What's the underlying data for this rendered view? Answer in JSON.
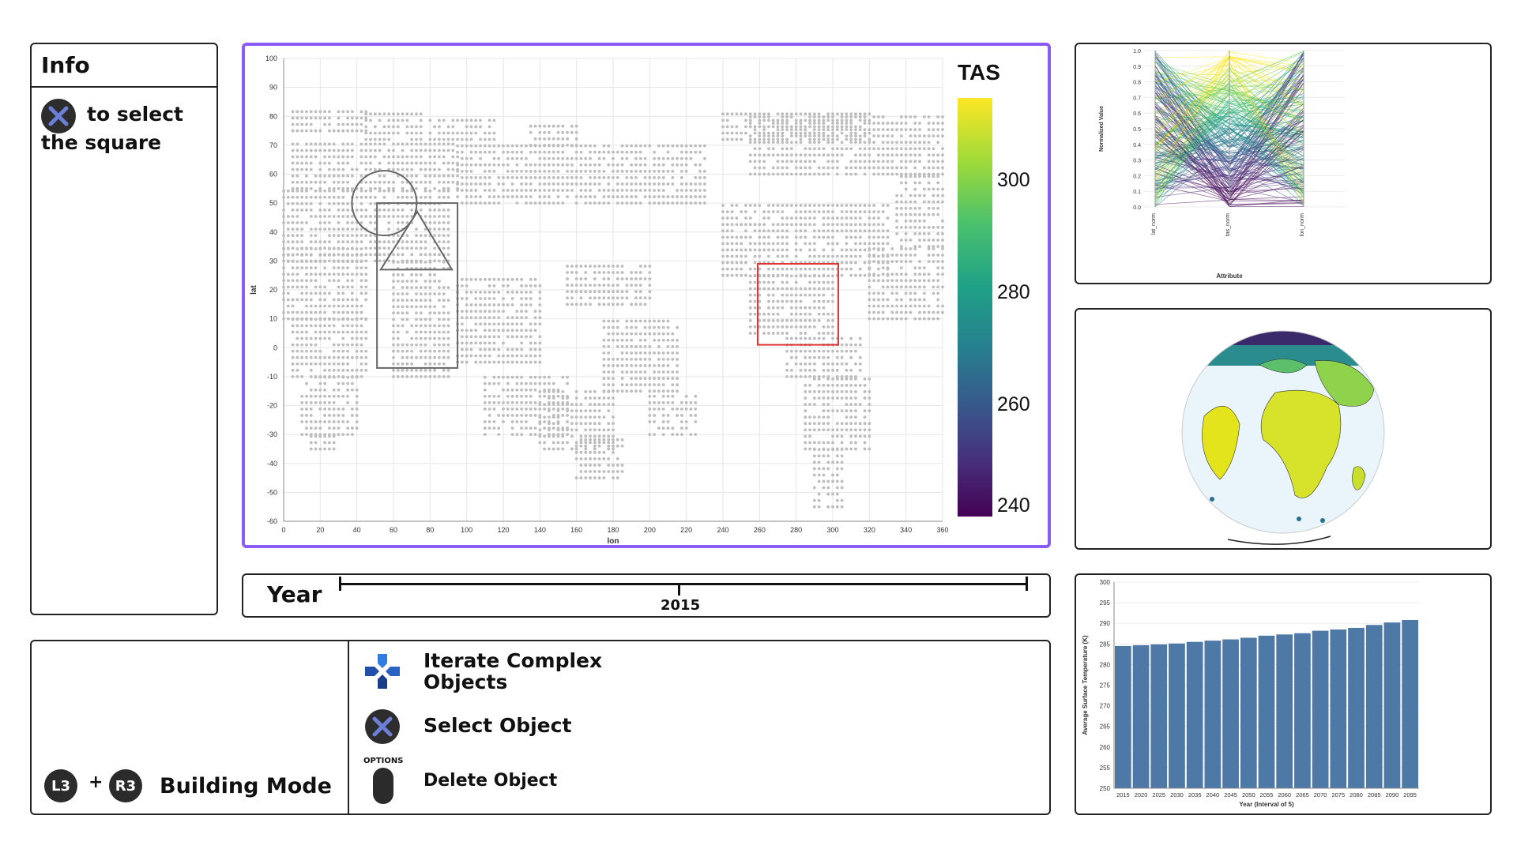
{
  "info": {
    "title": "Info",
    "hint_line1": "to select",
    "hint_line2": "the square"
  },
  "map": {
    "xlabel": "lon",
    "ylabel": "lat",
    "x_ticks": [
      "0",
      "20",
      "40",
      "60",
      "80",
      "100",
      "120",
      "140",
      "160",
      "180",
      "200",
      "220",
      "240",
      "260",
      "280",
      "300",
      "320",
      "340",
      "360"
    ],
    "y_ticks": [
      "100",
      "90",
      "80",
      "70",
      "60",
      "50",
      "40",
      "30",
      "20",
      "10",
      "0",
      "-10",
      "-20",
      "-30",
      "-40",
      "-50",
      "-60"
    ],
    "legend_title": "TAS",
    "legend_ticks": [
      "300",
      "280",
      "260",
      "240"
    ],
    "highlight_color": "#8a5cf5",
    "selection_color": "#e03030"
  },
  "year": {
    "label": "Year",
    "value": "2015"
  },
  "controls": {
    "mode_l3": "L3",
    "mode_plus": "+",
    "mode_r3": "R3",
    "mode_label": "Building Mode",
    "iterate_line1": "Iterate Complex",
    "iterate_line2": "Objects",
    "select_label": "Select Object",
    "options_label": "OPTIONS",
    "delete_label": "Delete Object"
  },
  "parallel": {
    "ylabel": "Normalized Value",
    "xlabel": "Attribute",
    "axes": [
      "lat_norm",
      "tas_norm",
      "lon_norm"
    ],
    "y_ticks": [
      "1.0",
      "0.9",
      "0.8",
      "0.7",
      "0.6",
      "0.5",
      "0.4",
      "0.3",
      "0.2",
      "0.1",
      "0.0"
    ]
  },
  "chart_data": {
    "type": "bar",
    "categories": [
      "2015",
      "2020",
      "2025",
      "2030",
      "2035",
      "2040",
      "2045",
      "2050",
      "2055",
      "2060",
      "2065",
      "2070",
      "2075",
      "2080",
      "2085",
      "2090",
      "2095"
    ],
    "values": [
      284.5,
      284.7,
      284.9,
      285.1,
      285.5,
      285.8,
      286.1,
      286.5,
      287.0,
      287.3,
      287.6,
      288.2,
      288.5,
      288.9,
      289.6,
      290.2,
      290.8
    ],
    "xlabel": "Year (Interval of 5)",
    "ylabel": "Average Surface Temperature (K)",
    "ylim": [
      250,
      300
    ],
    "y_ticks": [
      "300",
      "295",
      "290",
      "285",
      "280",
      "275",
      "270",
      "265",
      "260",
      "255",
      "250"
    ],
    "bar_color": "#4e79a7"
  }
}
